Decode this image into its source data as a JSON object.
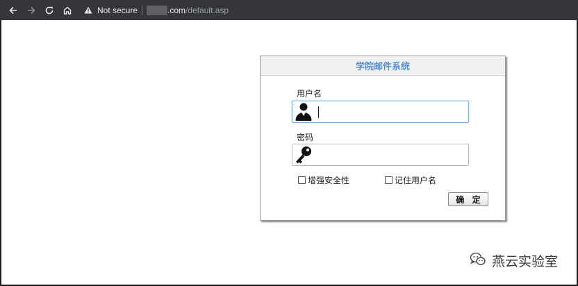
{
  "browser": {
    "security_label": "Not secure",
    "url_host": ".com",
    "url_path": "/default.asp"
  },
  "panel": {
    "title": "学院邮件系统",
    "username_label": "用户名",
    "username_value": "",
    "password_label": "密码",
    "password_value": "",
    "enhanced_security_label": "增强安全性",
    "remember_username_label": "记住用户名",
    "submit_label": "确 定"
  },
  "watermark": {
    "text": "燕云实验室"
  },
  "icons": {
    "back": "arrow-left-icon",
    "forward": "arrow-right-icon",
    "reload": "reload-icon",
    "home": "home-icon",
    "warning": "warning-triangle-icon",
    "user": "user-silhouette-icon",
    "key": "key-icon",
    "watermark": "wechat-logo-icon"
  },
  "colors": {
    "title_accent": "#5b8fd0",
    "browser_bar": "#35363a"
  }
}
